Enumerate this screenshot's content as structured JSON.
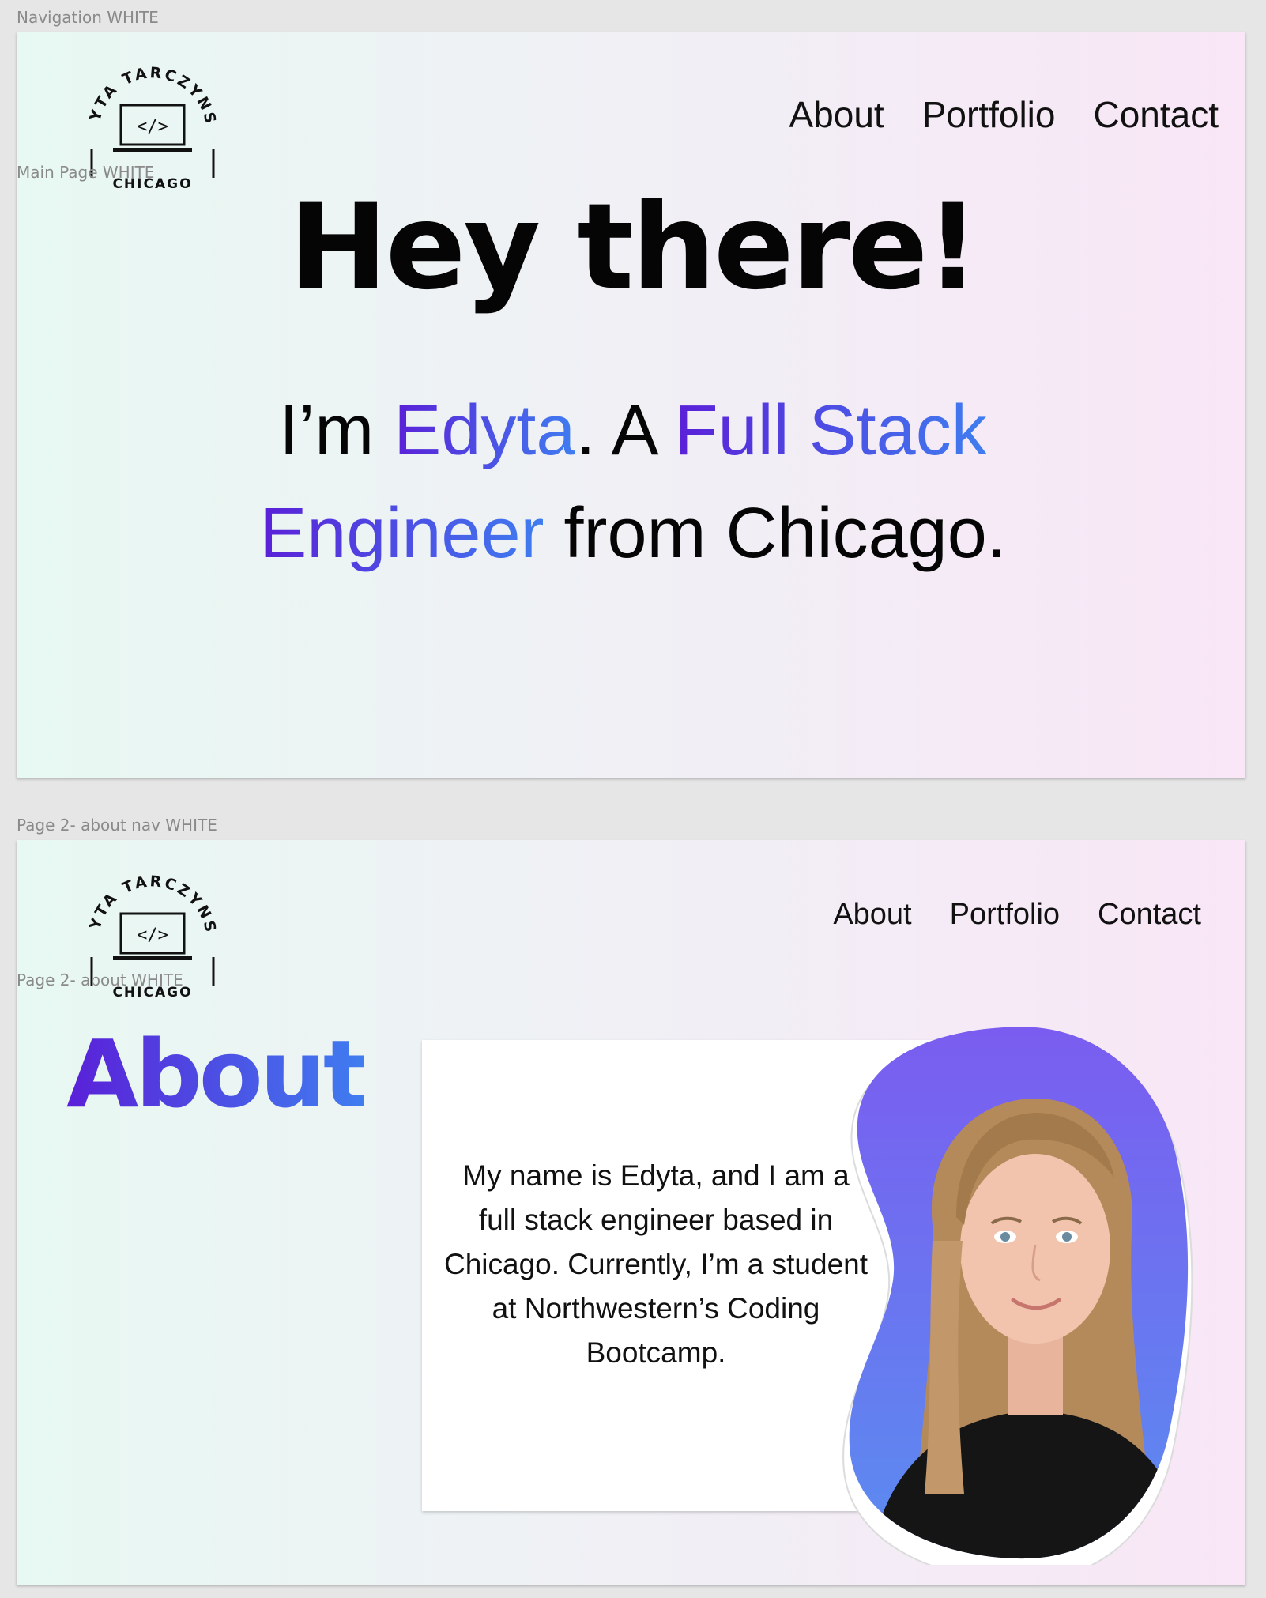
{
  "frames": {
    "navigation_label": "Navigation WHITE",
    "main_page_label": "Main Page WHITE",
    "about_nav_label": "Page 2- about nav WHITE",
    "about_page_label": "Page 2- about WHITE"
  },
  "logo": {
    "arc_text": "EDYTA TARCZYNSKI",
    "code_symbol": "</>",
    "city": "CHICAGO"
  },
  "nav": {
    "items": [
      "About",
      "Portfolio",
      "Contact"
    ]
  },
  "hero": {
    "title": "Hey there!",
    "im": "I’m",
    "name": "Edyta",
    "after_name": ". A",
    "role_line1": "Full Stack",
    "role_line2": "Engineer",
    "location": "from Chicago."
  },
  "about": {
    "title": "About",
    "body": "My name is Edyta, and I am a full stack engineer based in Chicago. Currently, I’m a student at Northwestern’s Coding Bootcamp.",
    "photo_icon": "portrait-photo"
  },
  "colors": {
    "accent_purple": "#5a20d8",
    "accent_blue": "#3f7df0",
    "bg_mint": "#e8f8f2",
    "bg_pink": "#f9e6f6"
  }
}
